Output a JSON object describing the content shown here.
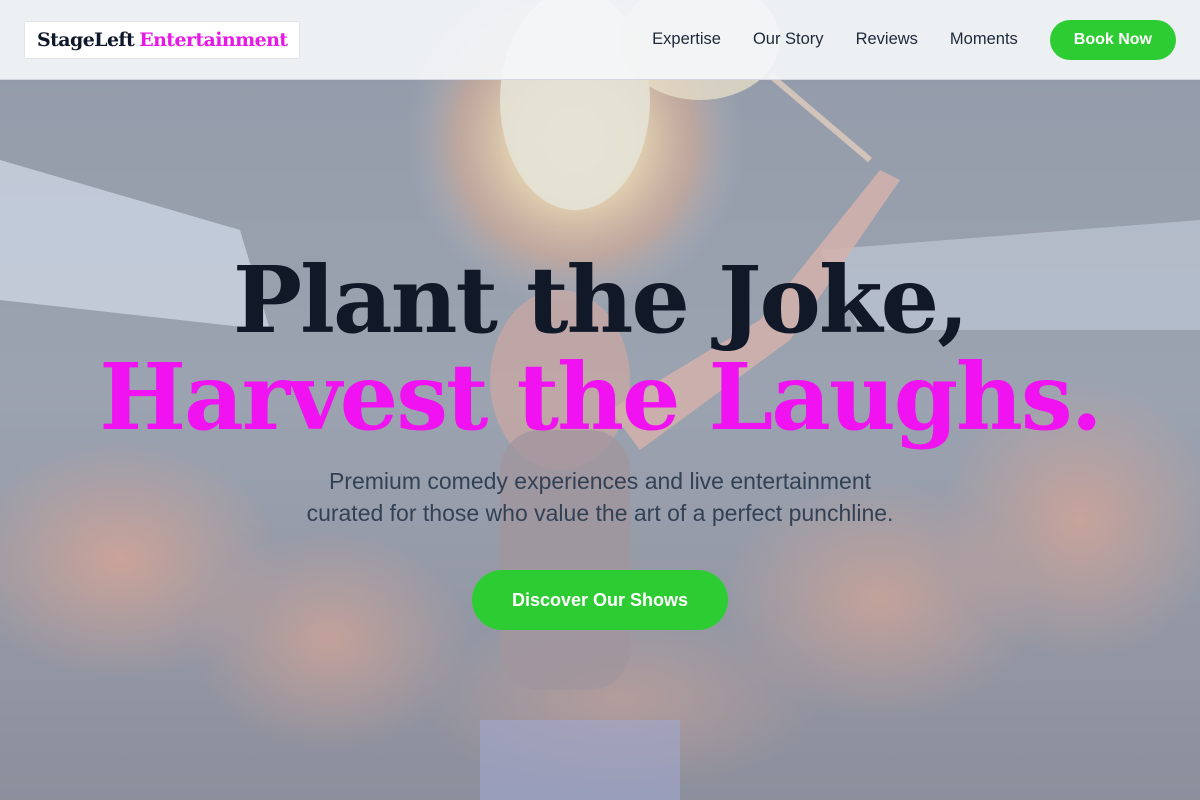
{
  "brand": {
    "name_part1": "StageLeft",
    "name_part2": "Entertainment"
  },
  "nav": {
    "items": [
      "Expertise",
      "Our Story",
      "Reviews",
      "Moments"
    ],
    "book_label": "Book Now"
  },
  "hero": {
    "headline_line1": "Plant the Joke,",
    "headline_line2": "Harvest the Laughs.",
    "subtitle_line1": "Premium comedy experiences and live entertainment",
    "subtitle_line2": "curated for those who value the art of a perfect punchline.",
    "cta_label": "Discover Our Shows",
    "background_image": "fire-performer-photo"
  },
  "colors": {
    "accent_green": "#2ecc33",
    "accent_magenta": "#f012f0",
    "text_dark": "#111827"
  }
}
